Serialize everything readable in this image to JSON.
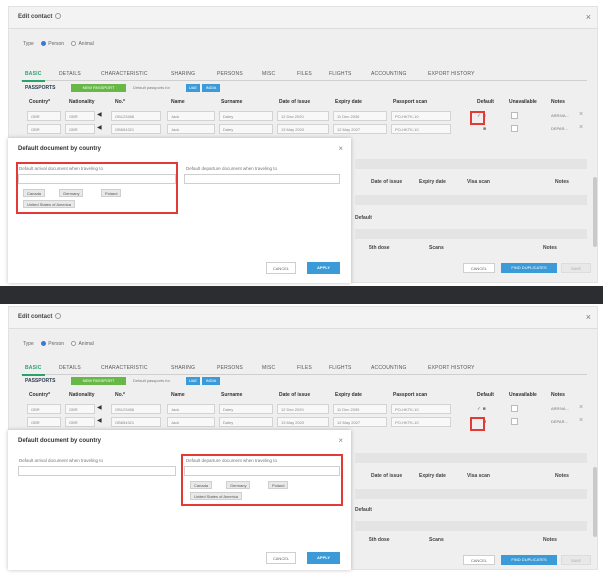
{
  "dialog": {
    "title": "Edit contact",
    "type_label": "Type",
    "type_person": "Person",
    "type_animal": "Animal"
  },
  "tabs": [
    "BASIC",
    "DETAILS",
    "CHARACTERISTIC",
    "SHARING",
    "PERSONS",
    "MISC",
    "FILES",
    "FLIGHTS",
    "ACCOUNTING",
    "EXPORT HISTORY"
  ],
  "passports": {
    "label": "PASSPORTS",
    "new_button": "NEW PASSPORT",
    "default_text": "Default passports for",
    "pill1": "UAE",
    "pill2": "INDIA"
  },
  "columns": [
    "Country*",
    "Nationality",
    "No.*",
    "Name",
    "Surname",
    "Date of issue",
    "Expiry date",
    "Passport scan",
    "Default",
    "Unavailable",
    "Notes"
  ],
  "rows": [
    {
      "country": "GBR",
      "nationality": "GBR",
      "no": "GB123456",
      "name": "Jack",
      "surname": "Daley",
      "issue": "12 Dec 2020",
      "expiry": "11 Dec 2030",
      "scan": "PO-HKTK-10",
      "notes": "ARRIVA..."
    },
    {
      "country": "GBR",
      "nationality": "GBR",
      "no": "GB654321",
      "name": "Jack",
      "surname": "Daley",
      "issue": "13 May 2020",
      "expiry": "12 May 2027",
      "scan": "PO-HKTK-10",
      "notes": "DEPAR..."
    }
  ],
  "modal": {
    "title": "Default document by country",
    "arrival_label": "Default arrival document when traveling to",
    "departure_label": "Default departure document when traveling to",
    "countries": [
      "Canada",
      "Germany",
      "Poland",
      "United States of America"
    ],
    "cancel": "CANCEL",
    "apply": "APPLY"
  },
  "under": {
    "visa_cols": [
      "Date of issue",
      "Expiry date",
      "Visa scan",
      "Notes"
    ],
    "default_label": "Default",
    "bottom_cols": [
      "5th dose",
      "Scans",
      "Notes"
    ]
  },
  "footer": {
    "cancel": "CANCEL",
    "find_duplicates": "FIND DUPLICATES",
    "save": "SAVE"
  },
  "colors": {
    "accent_green": "#67b847",
    "accent_blue": "#3a9bd8",
    "highlight_red": "#e53935",
    "separator": "#2b2d30"
  }
}
